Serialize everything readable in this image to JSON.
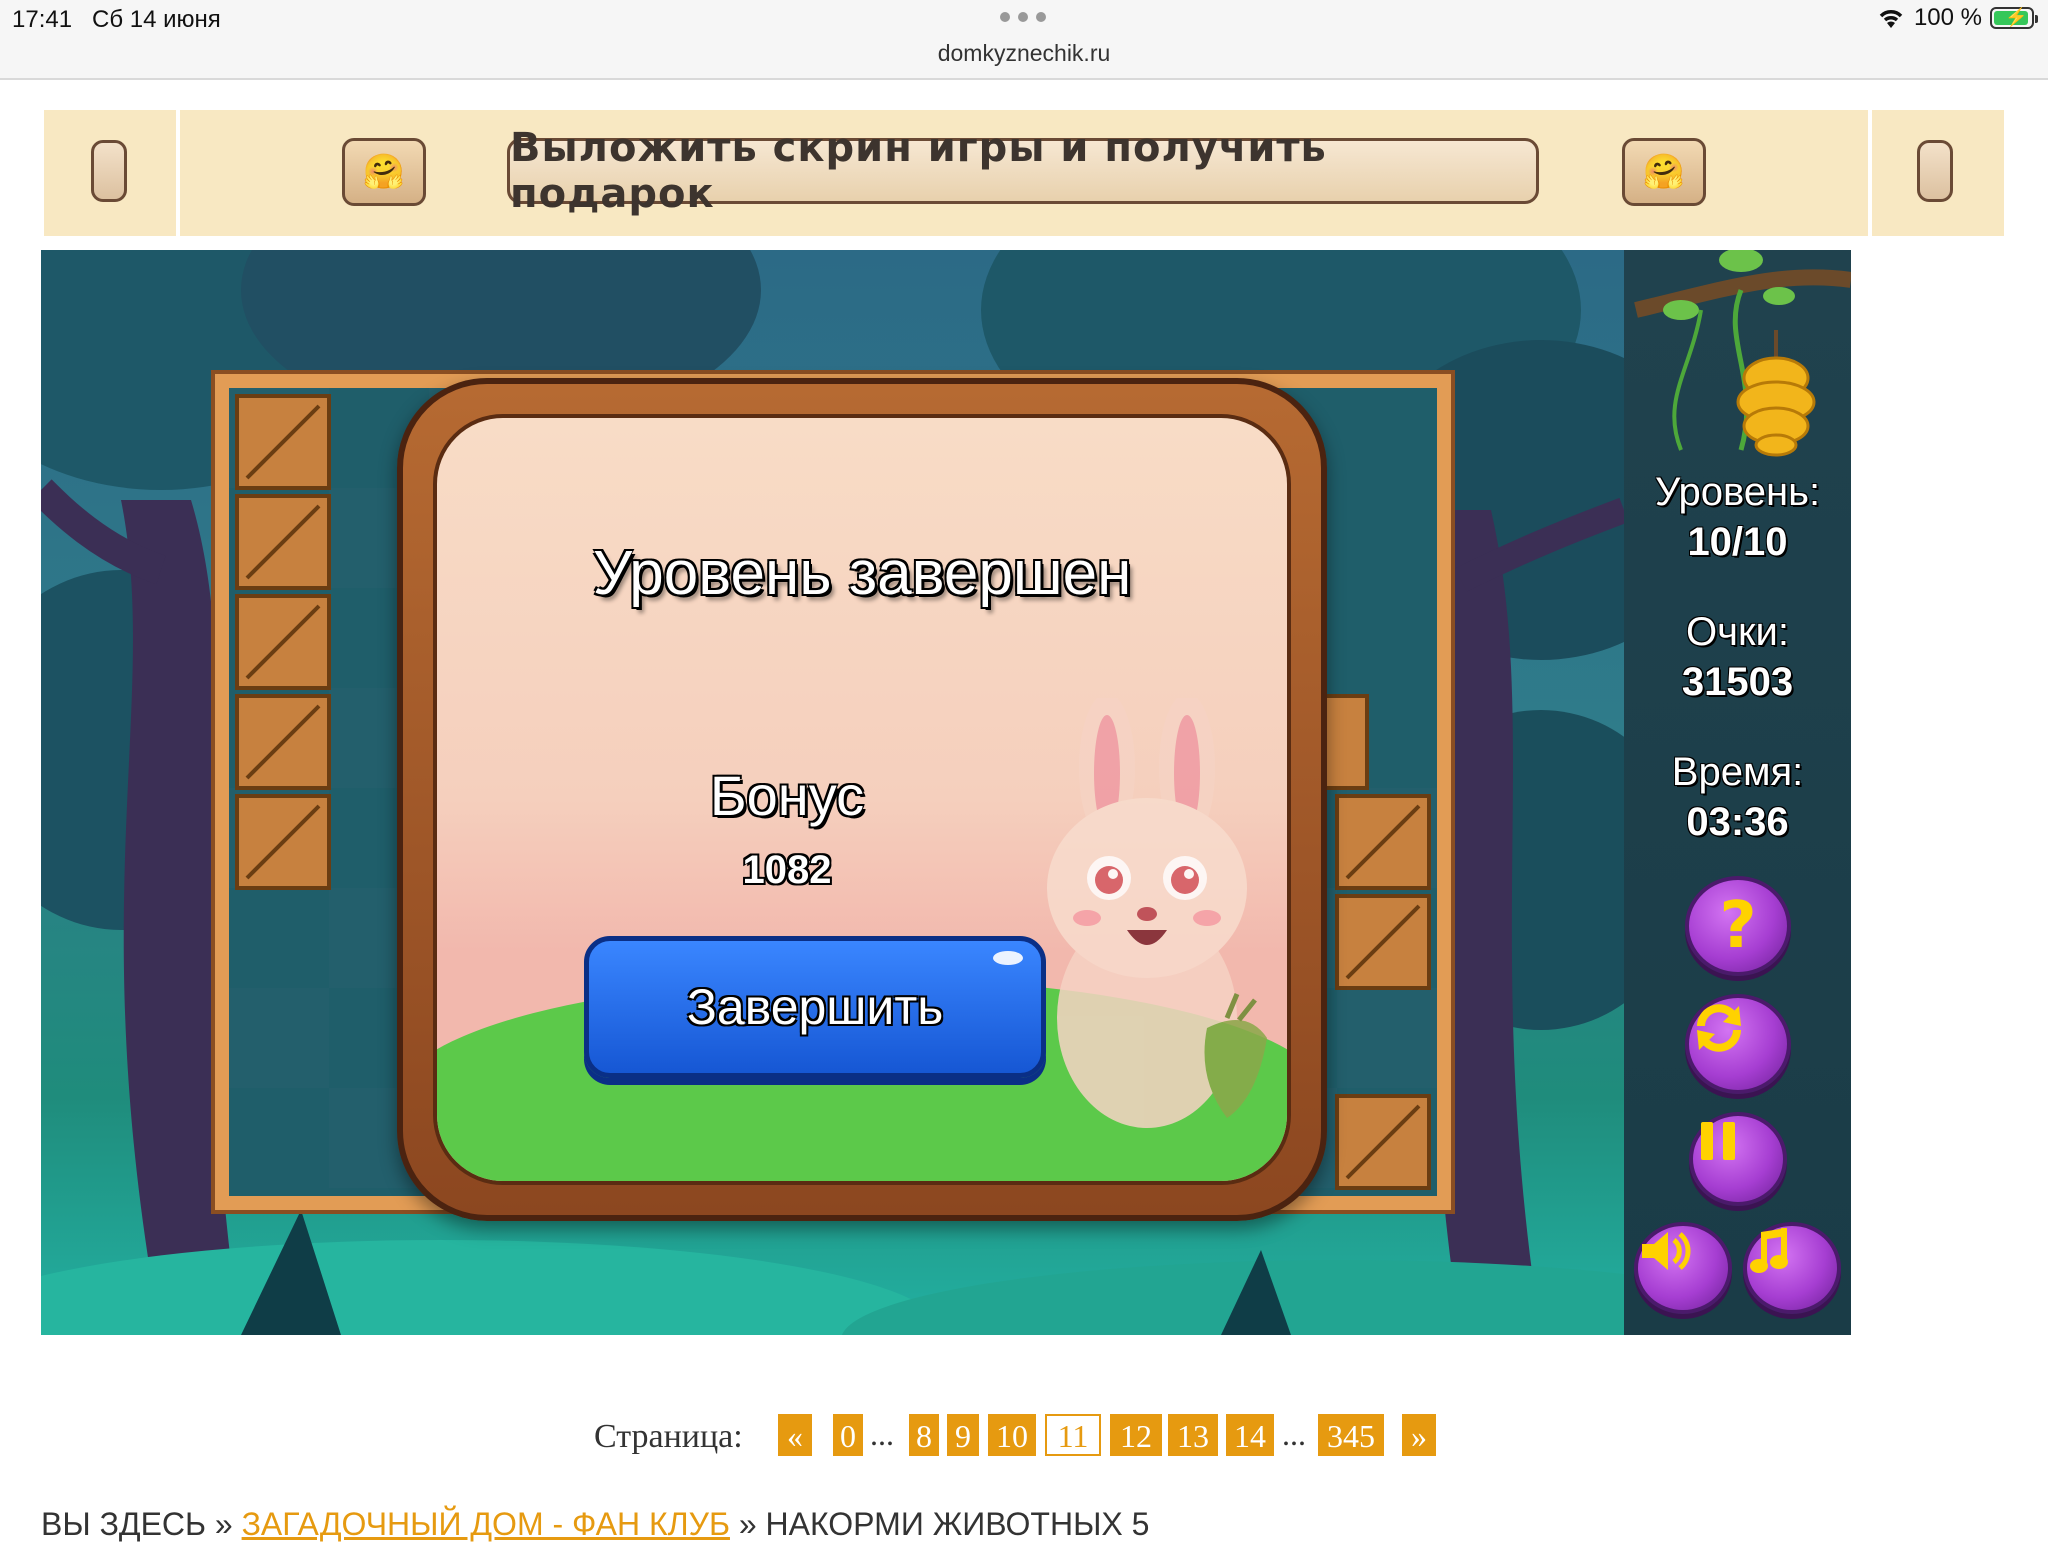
{
  "status_bar": {
    "time": "17:41",
    "date": "Сб 14 июня",
    "url": "domkyznechik.ru",
    "battery": "100 %"
  },
  "banner": {
    "text": "Выложить скрин игры и получить подарок",
    "emoji": "🤗"
  },
  "game": {
    "popup": {
      "title": "Уровень завершен",
      "bonus_label": "Бонус",
      "bonus_value": "1082",
      "finish_button": "Завершить"
    },
    "stats": {
      "level_label": "Уровень:",
      "level_value": "10/10",
      "score_label": "Очки:",
      "score_value": "31503",
      "time_label": "Время:",
      "time_value": "03:36"
    },
    "buttons": {
      "help": "?",
      "restart_icon": "restart-icon",
      "pause_icon": "pause-icon",
      "sound_icon": "speaker-icon",
      "music_icon": "music-note-icon"
    }
  },
  "pagination": {
    "label": "Страница:",
    "prev": "«",
    "next": "»",
    "ellipsis": "...",
    "pages": [
      "0",
      "8",
      "9",
      "10",
      "11",
      "12",
      "13",
      "14",
      "345"
    ],
    "current": "11"
  },
  "breadcrumb": {
    "prefix": "ВЫ ЗДЕСЬ",
    "separator": "»",
    "link": "ЗАГАДОЧНЫЙ ДОМ - ФАН КЛУБ",
    "current": "НАКОРМИ ЖИВОТНЫХ 5"
  },
  "colors": {
    "accent_orange": "#e69a10",
    "banner_bg": "#f8e8c2",
    "finish_button": "#1f6ae8",
    "control_purple": "#a63ed2",
    "control_icon": "#ffd200"
  }
}
